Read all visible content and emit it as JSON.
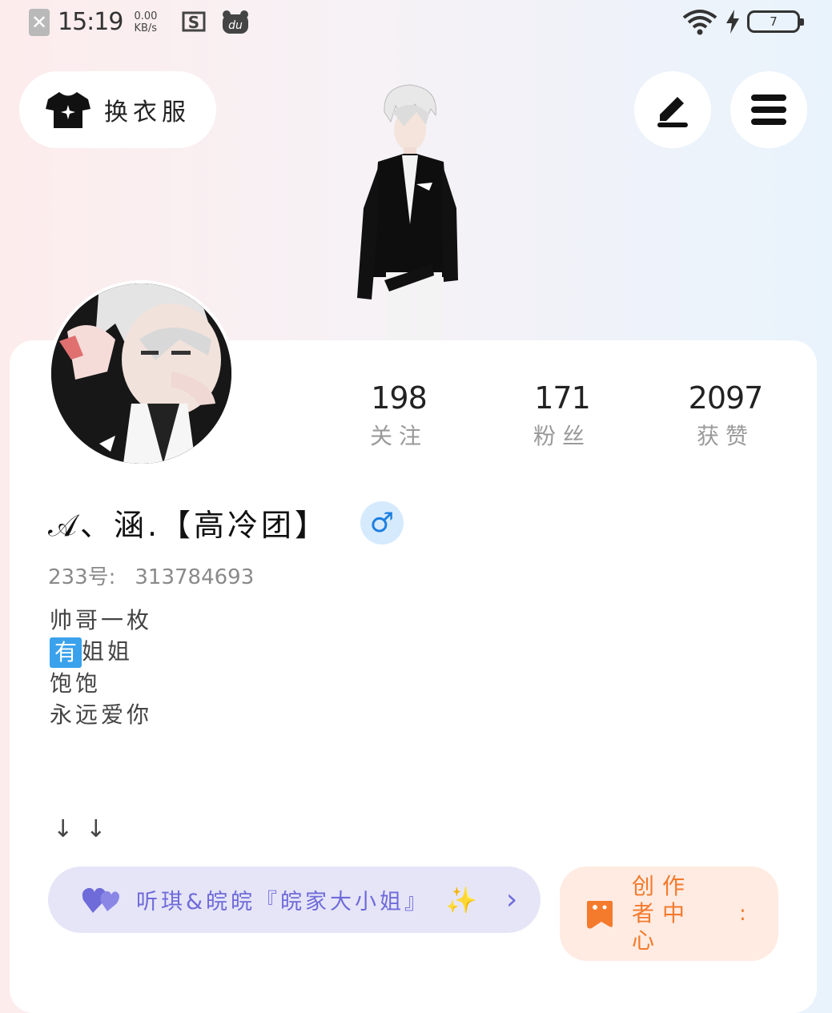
{
  "status_bar": {
    "time": "15:19",
    "net_speed": "0.00",
    "net_unit": "KB/s",
    "battery": "7"
  },
  "header": {
    "outfit_label": "换衣服"
  },
  "profile": {
    "name": "𝒜、涵.【高冷团】",
    "gender_symbol": "♂",
    "uid_label": "233号:",
    "uid": "313784693",
    "bio_line1": "帅哥一枚",
    "bio_badge": "有",
    "bio_line2_rest": "姐姐",
    "bio_line3": "饱饱",
    "bio_line4": "永远爱你",
    "arrows": "↓↓"
  },
  "stats": [
    {
      "value": "198",
      "label": "关注"
    },
    {
      "value": "171",
      "label": "粉丝"
    },
    {
      "value": "2097",
      "label": "获赞"
    }
  ],
  "fan_badge": {
    "label": "听琪&皖皖『皖家大小姐』",
    "sparkle": "✨",
    "chevron": "›"
  },
  "creator_center": {
    "label": "创作者中心",
    "dots": ":"
  },
  "colors": {
    "accent_purple": "#6f6bd9",
    "accent_orange": "#f47a2c",
    "gender_blue": "#1e7fe0"
  }
}
